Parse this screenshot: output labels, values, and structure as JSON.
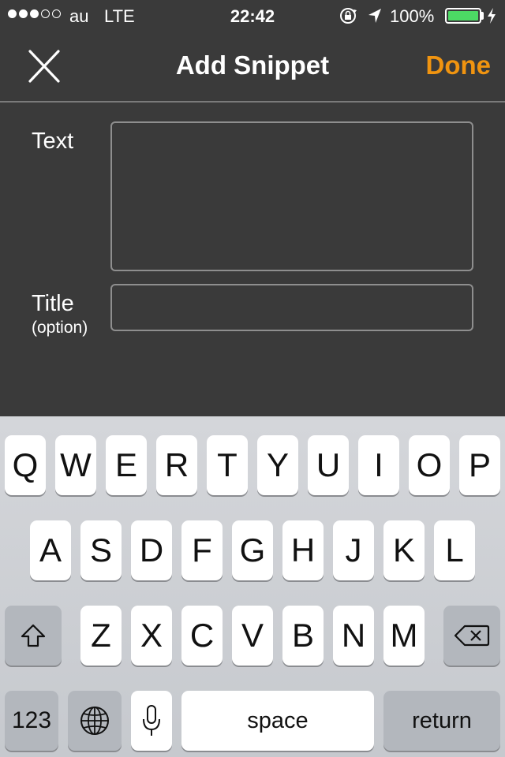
{
  "status_bar": {
    "carrier": "au",
    "network": "LTE",
    "time": "22:42",
    "battery_percent": "100%",
    "battery_level": 1.0,
    "signal_bars": 3,
    "signal_total": 5,
    "icons": [
      "rotation-lock-icon",
      "location-arrow-icon",
      "battery-icon",
      "charging-bolt-icon"
    ],
    "battery_color": "#4cd964"
  },
  "nav": {
    "title": "Add Snippet",
    "done_label": "Done",
    "close_icon": "close-icon",
    "accent_color": "#f09410"
  },
  "form": {
    "text_label": "Text",
    "text_value": "",
    "title_label": "Title",
    "title_sublabel": "(option)",
    "title_value": ""
  },
  "keyboard": {
    "row1": [
      "Q",
      "W",
      "E",
      "R",
      "T",
      "Y",
      "U",
      "I",
      "O",
      "P"
    ],
    "row2": [
      "A",
      "S",
      "D",
      "F",
      "G",
      "H",
      "J",
      "K",
      "L"
    ],
    "row3": [
      "Z",
      "X",
      "C",
      "V",
      "B",
      "N",
      "M"
    ],
    "numbers_label": "123",
    "space_label": "space",
    "return_label": "return",
    "icons": [
      "shift-icon",
      "backspace-icon",
      "globe-icon",
      "microphone-icon"
    ]
  }
}
